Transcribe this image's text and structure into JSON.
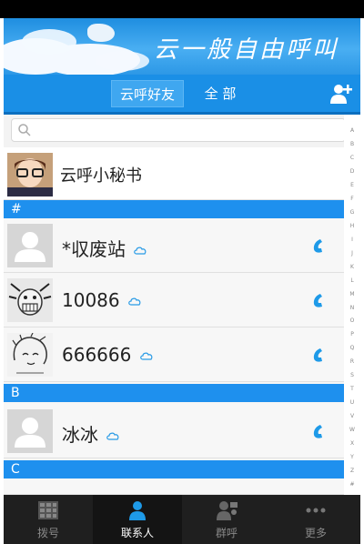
{
  "banner": {
    "slogan": "云一般自由呼叫"
  },
  "tabs": {
    "friends": "云呼好友",
    "all": "全 部"
  },
  "alpha_index": [
    "A",
    "B",
    "C",
    "D",
    "E",
    "F",
    "G",
    "H",
    "I",
    "J",
    "K",
    "L",
    "M",
    "N",
    "O",
    "P",
    "Q",
    "R",
    "S",
    "T",
    "U",
    "V",
    "W",
    "X",
    "Y",
    "Z",
    "#"
  ],
  "contacts": {
    "secretary": "云呼小秘书",
    "sections": [
      {
        "letter": "#",
        "items": [
          "*収废站",
          "10086",
          "666666"
        ]
      },
      {
        "letter": "B",
        "items": [
          "冰冰"
        ]
      },
      {
        "letter": "C",
        "items": []
      }
    ]
  },
  "nav": [
    {
      "label": "拨号",
      "icon": "dialpad-icon"
    },
    {
      "label": "联系人",
      "icon": "contacts-icon"
    },
    {
      "label": "群呼",
      "icon": "group-call-icon"
    },
    {
      "label": "更多",
      "icon": "more-icon"
    }
  ],
  "colors": {
    "accent": "#1a8fe6",
    "section": "#1e90ee",
    "phone": "#1e9ae8",
    "nav_bg": "#1f1f1f"
  }
}
